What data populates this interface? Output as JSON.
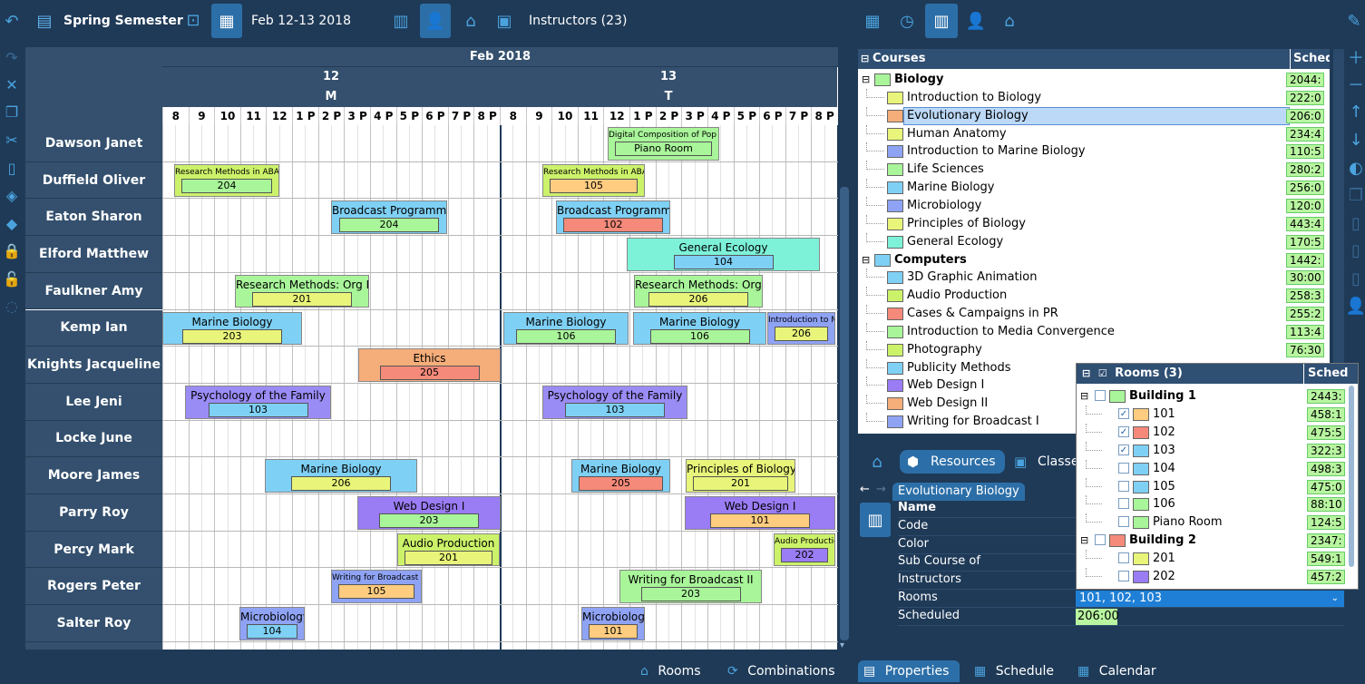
{
  "header": {
    "semester": "Spring Semester",
    "date_range": "Feb 12-13 2018",
    "instructors_label": "Instructors (23)"
  },
  "grid": {
    "month": "Feb 2018",
    "days": [
      {
        "num": "12",
        "dow": "M"
      },
      {
        "num": "13",
        "dow": "T"
      }
    ],
    "hours": [
      "8",
      "9",
      "10",
      "11",
      "12",
      "1 P",
      "2 P",
      "3 P",
      "4 P",
      "5 P",
      "6 P",
      "7 P",
      "8 P"
    ],
    "rows": [
      "Dawson Janet",
      "Duffield Oliver",
      "Eaton Sharon",
      "Elford Matthew",
      "Faulkner Amy",
      "Kemp Ian",
      "Knights Jacqueline",
      "Lee Jeni",
      "Locke June",
      "Moore James",
      "Parry Roy",
      "Percy Mark",
      "Rogers Peter",
      "Salter Roy"
    ],
    "events": [
      {
        "row": 0,
        "title": "Digital Composition of Pop Mu",
        "room": "Piano Room",
        "color": "#a9f59a",
        "roomcolor": "#a9f59a",
        "small": true
      },
      {
        "row": 1,
        "title": "Research Methods in ABA",
        "room": "204",
        "color": "#ccf26a",
        "roomcolor": "#a9f59a",
        "small": true
      },
      {
        "row": 1,
        "title": "Research Methods in ABA",
        "room": "105",
        "color": "#ccf26a",
        "roomcolor": "#ffcc80",
        "small": true
      },
      {
        "row": 2,
        "title": "Broadcast Programming",
        "room": "204",
        "color": "#7fd0f5",
        "roomcolor": "#a9f59a"
      },
      {
        "row": 2,
        "title": "Broadcast Programming",
        "room": "102",
        "color": "#7fd0f5",
        "roomcolor": "#f58a7a"
      },
      {
        "row": 3,
        "title": "General Ecology",
        "room": "104",
        "color": "#7df2d8",
        "roomcolor": "#7fd0f5"
      },
      {
        "row": 4,
        "title": "Research Methods: Org Psy",
        "room": "201",
        "color": "#a9f59a",
        "roomcolor": "#e8f57a"
      },
      {
        "row": 4,
        "title": "Research Methods: Org Psy",
        "room": "206",
        "color": "#a9f59a",
        "roomcolor": "#e8f57a"
      },
      {
        "row": 5,
        "title": "Marine Biology",
        "room": "203",
        "color": "#7fd0f5",
        "roomcolor": "#e8f57a"
      },
      {
        "row": 5,
        "title": "Marine Biology",
        "room": "106",
        "color": "#7fd0f5",
        "roomcolor": "#a9f59a"
      },
      {
        "row": 5,
        "title": "Marine Biology",
        "room": "106",
        "color": "#7fd0f5",
        "roomcolor": "#a9f59a"
      },
      {
        "row": 5,
        "title": "Introduction to M",
        "room": "206",
        "color": "#8fa3f5",
        "roomcolor": "#e8f57a",
        "small": true
      },
      {
        "row": 6,
        "title": "Ethics",
        "room": "205",
        "color": "#f5ad7a",
        "roomcolor": "#f58a7a"
      },
      {
        "row": 7,
        "title": "Psychology of the Family",
        "room": "103",
        "color": "#9a8cf5",
        "roomcolor": "#7fd0f5"
      },
      {
        "row": 7,
        "title": "Psychology of the Family",
        "room": "103",
        "color": "#9a8cf5",
        "roomcolor": "#7fd0f5"
      },
      {
        "row": 9,
        "title": "Marine Biology",
        "room": "206",
        "color": "#7fd0f5",
        "roomcolor": "#e8f57a"
      },
      {
        "row": 9,
        "title": "Marine Biology",
        "room": "205",
        "color": "#7fd0f5",
        "roomcolor": "#f58a7a"
      },
      {
        "row": 9,
        "title": "Principles of Biology",
        "room": "201",
        "color": "#e8f57a",
        "roomcolor": "#e8f57a"
      },
      {
        "row": 10,
        "title": "Web Design I",
        "room": "203",
        "color": "#9a7cf5",
        "roomcolor": "#a9f59a"
      },
      {
        "row": 10,
        "title": "Web Design I",
        "room": "101",
        "color": "#9a7cf5",
        "roomcolor": "#ffcc80"
      },
      {
        "row": 11,
        "title": "Audio Production",
        "room": "201",
        "color": "#ccf26a",
        "roomcolor": "#e8f57a"
      },
      {
        "row": 11,
        "title": "Audio Production",
        "room": "202",
        "color": "#ccf26a",
        "roomcolor": "#9a7cf5",
        "small": true
      },
      {
        "row": 12,
        "title": "Writing for Broadcast I",
        "room": "105",
        "color": "#8fa3f5",
        "roomcolor": "#ffcc80",
        "small": true
      },
      {
        "row": 12,
        "title": "Writing for Broadcast II",
        "room": "203",
        "color": "#a9f59a",
        "roomcolor": "#a9f59a"
      },
      {
        "row": 13,
        "title": "Microbiology",
        "room": "104",
        "color": "#8fa3f5",
        "roomcolor": "#7fd0f5"
      },
      {
        "row": 13,
        "title": "Microbiology",
        "room": "101",
        "color": "#8fa3f5",
        "roomcolor": "#ffcc80"
      }
    ]
  },
  "courses": {
    "header": "Courses",
    "sched_header": "Sched",
    "items": [
      {
        "label": "Biology",
        "sched": "2044:",
        "color": "#a9f59a",
        "group": true
      },
      {
        "label": "Introduction to Biology",
        "sched": "222:0",
        "color": "#e8f57a"
      },
      {
        "label": "Evolutionary Biology",
        "sched": "206:0",
        "color": "#f5ad7a",
        "selected": true
      },
      {
        "label": "Human Anatomy",
        "sched": "234:4",
        "color": "#e8f57a"
      },
      {
        "label": "Introduction to Marine Biology",
        "sched": "110:5",
        "color": "#8fa3f5"
      },
      {
        "label": "Life Sciences",
        "sched": "280:2",
        "color": "#a9f59a"
      },
      {
        "label": "Marine Biology",
        "sched": "256:0",
        "color": "#7fd0f5"
      },
      {
        "label": "Microbiology",
        "sched": "120:0",
        "color": "#8fa3f5"
      },
      {
        "label": "Principles of Biology",
        "sched": "443:4",
        "color": "#e8f57a"
      },
      {
        "label": "General Ecology",
        "sched": "170:5",
        "color": "#7df2d8"
      },
      {
        "label": "Computers",
        "sched": "1442:",
        "color": "#7fd0f5",
        "group": true
      },
      {
        "label": "3D Graphic Animation",
        "sched": "30:00",
        "color": "#7fd0f5"
      },
      {
        "label": "Audio Production",
        "sched": "258:3",
        "color": "#ccf26a"
      },
      {
        "label": "Cases & Campaigns in PR",
        "sched": "255:2",
        "color": "#f58a7a"
      },
      {
        "label": "Introduction to Media Convergence",
        "sched": "113:4",
        "color": "#a9f59a"
      },
      {
        "label": "Photography",
        "sched": "76:30",
        "color": "#ccf26a"
      },
      {
        "label": "Publicity Methods",
        "sched": "",
        "color": "#7fd0f5"
      },
      {
        "label": "Web Design I",
        "sched": "",
        "color": "#9a7cf5"
      },
      {
        "label": "Web Design II",
        "sched": "",
        "color": "#f5ad7a"
      },
      {
        "label": "Writing for Broadcast I",
        "sched": "",
        "color": "#8fa3f5"
      }
    ]
  },
  "rooms": {
    "header": "Rooms (3)",
    "sched_header": "Sched",
    "items": [
      {
        "label": "Building 1",
        "sched": "2443:",
        "color": "#a9f59a",
        "group": true,
        "checked": false
      },
      {
        "label": "101",
        "sched": "458:1",
        "color": "#ffcc80",
        "checked": true
      },
      {
        "label": "102",
        "sched": "475:5",
        "color": "#f58a7a",
        "checked": true
      },
      {
        "label": "103",
        "sched": "322:3",
        "color": "#7fd0f5",
        "checked": true
      },
      {
        "label": "104",
        "sched": "498:3",
        "color": "#7fd0f5",
        "checked": false
      },
      {
        "label": "105",
        "sched": "475:0",
        "color": "#7fd0f5",
        "checked": false
      },
      {
        "label": "106",
        "sched": "88:10",
        "color": "#a9f59a",
        "checked": false
      },
      {
        "label": "Piano Room",
        "sched": "124:5",
        "color": "#a9f59a",
        "checked": false
      },
      {
        "label": "Building 2",
        "sched": "2347:",
        "color": "#f58a7a",
        "group": true,
        "checked": false
      },
      {
        "label": "201",
        "sched": "549:1",
        "color": "#e8f57a",
        "checked": false
      },
      {
        "label": "202",
        "sched": "457:2",
        "color": "#9a7cf5",
        "checked": false
      }
    ]
  },
  "tabs": {
    "resources": "Resources",
    "classes": "Classe"
  },
  "properties": {
    "course": "Evolutionary Biology",
    "labels": [
      "Name",
      "Code",
      "Color",
      "Sub Course of",
      "Instructors",
      "Rooms",
      "Scheduled"
    ],
    "rooms_value": "101, 102, 103",
    "scheduled_value": "206:00"
  },
  "bottom": {
    "rooms": "Rooms",
    "combinations": "Combinations",
    "properties": "Properties",
    "schedule": "Schedule",
    "calendar": "Calendar"
  }
}
